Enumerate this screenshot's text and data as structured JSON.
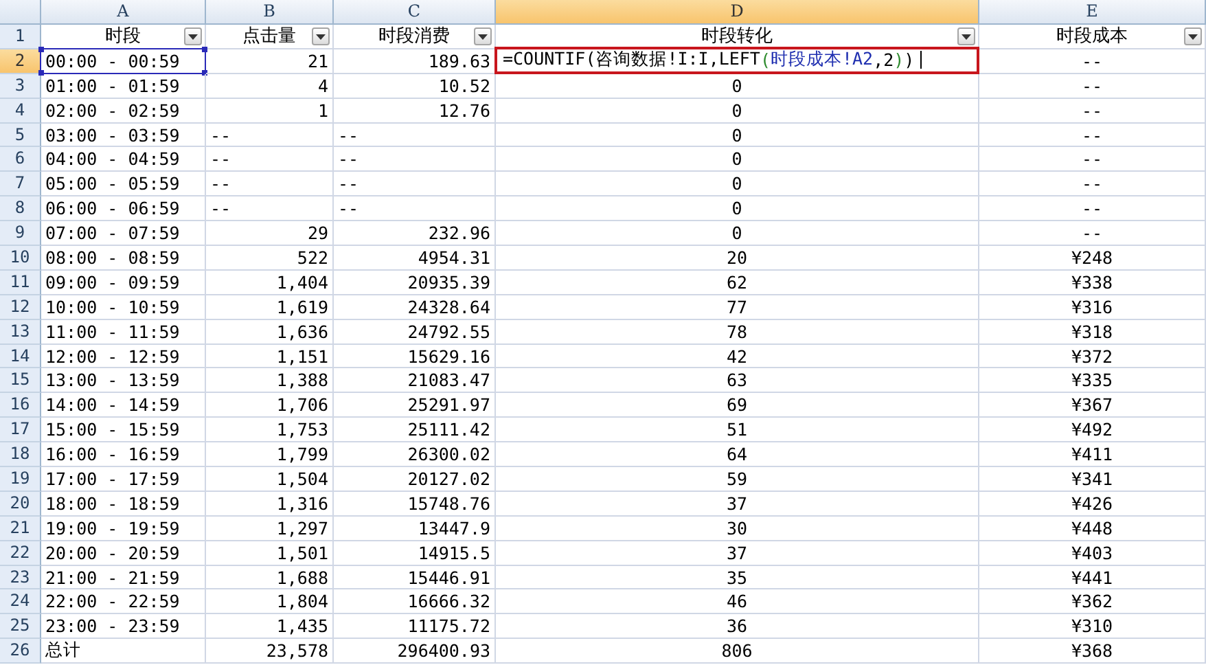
{
  "columns": [
    {
      "letter": "A",
      "selected": false
    },
    {
      "letter": "B",
      "selected": false
    },
    {
      "letter": "C",
      "selected": false
    },
    {
      "letter": "D",
      "selected": true
    },
    {
      "letter": "E",
      "selected": false
    }
  ],
  "rows": [
    {
      "number": "1",
      "selected": false,
      "kind": "header",
      "cells": [
        "时段",
        "点击量",
        "时段消费",
        "时段转化",
        "时段成本"
      ]
    },
    {
      "number": "2",
      "selected": true,
      "kind": "data",
      "cells": [
        {
          "kind": "referenced",
          "text": "00:00 - 00:59"
        },
        "21",
        "189.63",
        {
          "kind": "formula",
          "segments": [
            {
              "text": "=COUNTIF(咨询数据!I:I,LEFT",
              "color": "#000000"
            },
            {
              "text": "(",
              "color": "#2e8b2e"
            },
            {
              "text": "时段成本!A2",
              "color": "#1f2fb0"
            },
            {
              "text": ",2",
              "color": "#000000"
            },
            {
              "text": ")",
              "color": "#2e8b2e"
            },
            {
              "text": ")",
              "color": "#000000"
            }
          ]
        },
        "--"
      ]
    },
    {
      "number": "3",
      "selected": false,
      "kind": "data",
      "cells": [
        "01:00 - 01:59",
        "4",
        "10.52",
        "0",
        "--"
      ]
    },
    {
      "number": "4",
      "selected": false,
      "kind": "data",
      "cells": [
        "02:00 - 02:59",
        "1",
        "12.76",
        "0",
        "--"
      ]
    },
    {
      "number": "5",
      "selected": false,
      "kind": "data",
      "cells": [
        "03:00 - 03:59",
        {
          "kind": "text",
          "text": "--"
        },
        {
          "kind": "text",
          "text": "--"
        },
        "0",
        "--"
      ]
    },
    {
      "number": "6",
      "selected": false,
      "kind": "data",
      "cells": [
        "04:00 - 04:59",
        {
          "kind": "text",
          "text": "--"
        },
        {
          "kind": "text",
          "text": "--"
        },
        "0",
        "--"
      ]
    },
    {
      "number": "7",
      "selected": false,
      "kind": "data",
      "cells": [
        "05:00 - 05:59",
        {
          "kind": "text",
          "text": "--"
        },
        {
          "kind": "text",
          "text": "--"
        },
        "0",
        "--"
      ]
    },
    {
      "number": "8",
      "selected": false,
      "kind": "data",
      "cells": [
        "06:00 - 06:59",
        {
          "kind": "text",
          "text": "--"
        },
        {
          "kind": "text",
          "text": "--"
        },
        "0",
        "--"
      ]
    },
    {
      "number": "9",
      "selected": false,
      "kind": "data",
      "cells": [
        "07:00 - 07:59",
        "29",
        "232.96",
        "0",
        "--"
      ]
    },
    {
      "number": "10",
      "selected": false,
      "kind": "data",
      "cells": [
        "08:00 - 08:59",
        "522",
        "4954.31",
        "20",
        "¥248"
      ]
    },
    {
      "number": "11",
      "selected": false,
      "kind": "data",
      "cells": [
        "09:00 - 09:59",
        "1,404",
        "20935.39",
        "62",
        "¥338"
      ]
    },
    {
      "number": "12",
      "selected": false,
      "kind": "data",
      "cells": [
        "10:00 - 10:59",
        "1,619",
        "24328.64",
        "77",
        "¥316"
      ]
    },
    {
      "number": "13",
      "selected": false,
      "kind": "data",
      "cells": [
        "11:00 - 11:59",
        "1,636",
        "24792.55",
        "78",
        "¥318"
      ]
    },
    {
      "number": "14",
      "selected": false,
      "kind": "data",
      "cells": [
        "12:00 - 12:59",
        "1,151",
        "15629.16",
        "42",
        "¥372"
      ]
    },
    {
      "number": "15",
      "selected": false,
      "kind": "data",
      "cells": [
        "13:00 - 13:59",
        "1,388",
        "21083.47",
        "63",
        "¥335"
      ]
    },
    {
      "number": "16",
      "selected": false,
      "kind": "data",
      "cells": [
        "14:00 - 14:59",
        "1,706",
        "25291.97",
        "69",
        "¥367"
      ]
    },
    {
      "number": "17",
      "selected": false,
      "kind": "data",
      "cells": [
        "15:00 - 15:59",
        "1,753",
        "25111.42",
        "51",
        "¥492"
      ]
    },
    {
      "number": "18",
      "selected": false,
      "kind": "data",
      "cells": [
        "16:00 - 16:59",
        "1,799",
        "26300.02",
        "64",
        "¥411"
      ]
    },
    {
      "number": "19",
      "selected": false,
      "kind": "data",
      "cells": [
        "17:00 - 17:59",
        "1,504",
        "20127.02",
        "59",
        "¥341"
      ]
    },
    {
      "number": "20",
      "selected": false,
      "kind": "data",
      "cells": [
        "18:00 - 18:59",
        "1,316",
        "15748.76",
        "37",
        "¥426"
      ]
    },
    {
      "number": "21",
      "selected": false,
      "kind": "data",
      "cells": [
        "19:00 - 19:59",
        "1,297",
        "13447.9",
        "30",
        "¥448"
      ]
    },
    {
      "number": "22",
      "selected": false,
      "kind": "data",
      "cells": [
        "20:00 - 20:59",
        "1,501",
        "14915.5",
        "37",
        "¥403"
      ]
    },
    {
      "number": "23",
      "selected": false,
      "kind": "data",
      "cells": [
        "21:00 - 21:59",
        "1,688",
        "15446.91",
        "35",
        "¥441"
      ]
    },
    {
      "number": "24",
      "selected": false,
      "kind": "data",
      "cells": [
        "22:00 - 22:59",
        "1,804",
        "16666.32",
        "46",
        "¥362"
      ]
    },
    {
      "number": "25",
      "selected": false,
      "kind": "data",
      "cells": [
        "23:00 - 23:59",
        "1,435",
        "11175.72",
        "36",
        "¥310"
      ]
    },
    {
      "number": "26",
      "selected": false,
      "kind": "data",
      "cells": [
        "总计",
        "23,578",
        "296400.93",
        "806",
        "¥368"
      ]
    }
  ]
}
